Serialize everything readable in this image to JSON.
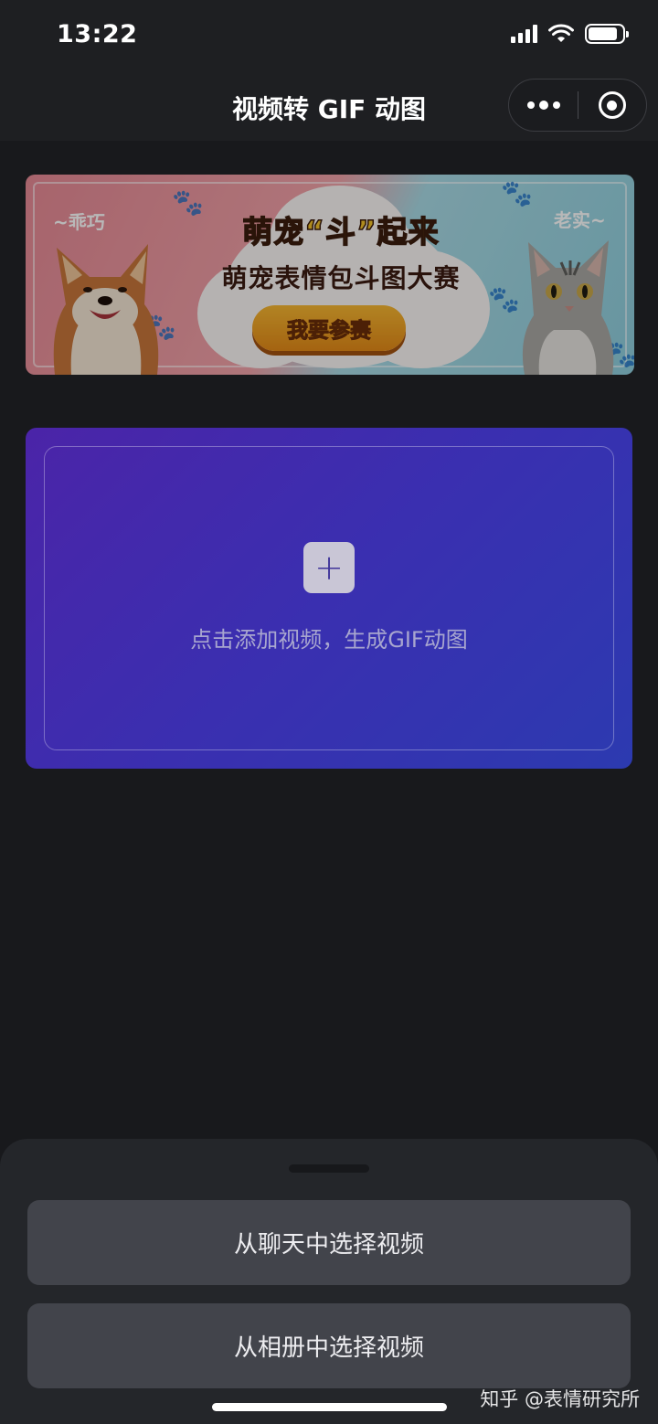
{
  "status_bar": {
    "time": "13:22",
    "battery_level": 0.85
  },
  "nav": {
    "title": "视频转 GIF 动图",
    "more_icon": "more-dots-icon",
    "close_icon": "target-close-icon"
  },
  "banner": {
    "headline": "萌宠“斗”起来",
    "subheadline": "萌宠表情包斗图大赛",
    "cta": "我要参赛",
    "left_tag": "~乖巧",
    "right_tag": "老实~",
    "colors": {
      "left": "#e88a96",
      "right": "#8fd0df",
      "button": "#f7b731"
    }
  },
  "upload": {
    "icon": "plus-icon",
    "text": "点击添加视频，生成GIF动图",
    "colors": {
      "start": "#4b24a8",
      "end": "#2c3ab0"
    }
  },
  "sheet": {
    "options": [
      {
        "label": "从聊天中选择视频"
      },
      {
        "label": "从相册中选择视频"
      }
    ]
  },
  "watermark": "知乎 @表情研究所"
}
